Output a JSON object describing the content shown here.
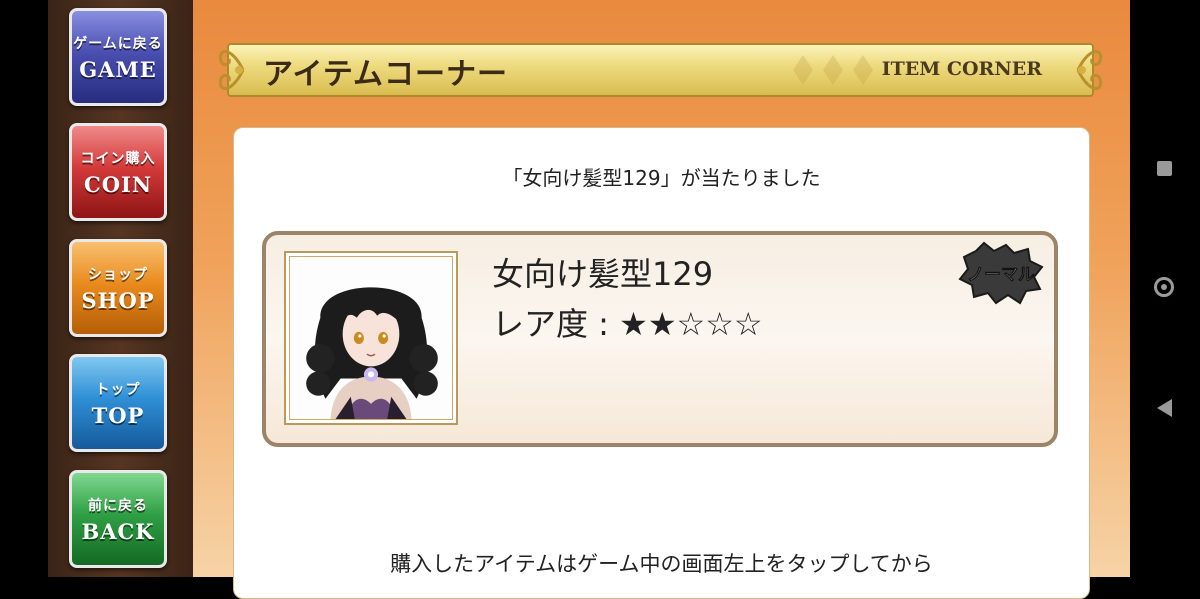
{
  "sidebar": {
    "buttons": [
      {
        "jp": "ゲームに戻る",
        "en": "GAME"
      },
      {
        "jp": "コイン購入",
        "en": "COIN"
      },
      {
        "jp": "ショップ",
        "en": "SHOP"
      },
      {
        "jp": "トップ",
        "en": "TOP"
      },
      {
        "jp": "前に戻る",
        "en": "BACK"
      }
    ]
  },
  "header": {
    "title": "アイテムコーナー",
    "subtitle": "ITEM CORNER"
  },
  "result": {
    "message": "「女向け髪型129」が当たりました",
    "item": {
      "name": "女向け髪型129",
      "rarity_label": "レア度 : ★★☆☆☆",
      "rarity_stars": 2,
      "rarity_max": 5,
      "badge": "ノーマル"
    },
    "footer_text": "購入したアイテムはゲーム中の画面左上をタップしてから"
  },
  "colors": {
    "accent_orange": "#e98a3e",
    "card_border": "#9c8468",
    "banner_gold": "#eedb80"
  }
}
